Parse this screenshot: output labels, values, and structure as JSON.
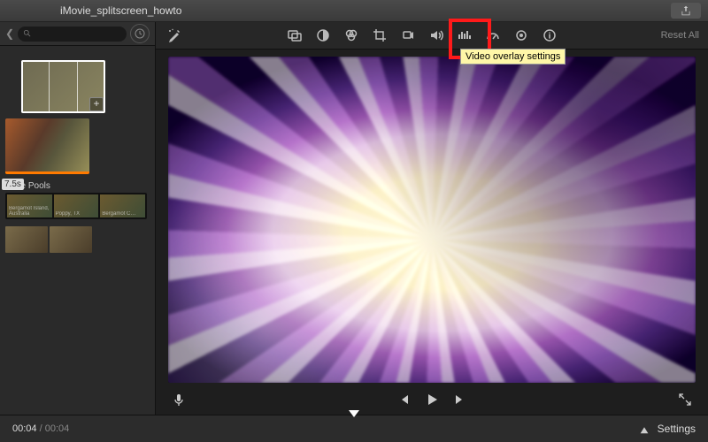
{
  "titlebar": {
    "project_name": "iMovie_splitscreen_howto"
  },
  "left": {
    "search_placeholder": "",
    "clip_duration_badge": "7.5s",
    "title_card": {
      "heading": "Tide Pools",
      "sub1": "Bergamot Island, Australia",
      "sub2": "Poppy, TX",
      "sub3": "Bergamot C…"
    }
  },
  "toolbar": {
    "tooltip": "Video overlay settings",
    "reset_label": "Reset All",
    "tools": [
      {
        "name": "auto-enhance-icon"
      },
      {
        "name": "video-overlay-icon"
      },
      {
        "name": "color-balance-icon"
      },
      {
        "name": "color-correction-icon"
      },
      {
        "name": "crop-icon"
      },
      {
        "name": "stabilization-icon"
      },
      {
        "name": "volume-icon"
      },
      {
        "name": "noise-eq-icon"
      },
      {
        "name": "speed-icon"
      },
      {
        "name": "filter-icon"
      },
      {
        "name": "info-icon"
      }
    ]
  },
  "transport": {
    "mic": "mic-icon",
    "prev": "prev-icon",
    "play": "play-icon",
    "next": "next-icon",
    "expand": "fullscreen-icon"
  },
  "timeline": {
    "current": "00:04",
    "total": "00:04",
    "settings_label": "Settings"
  }
}
